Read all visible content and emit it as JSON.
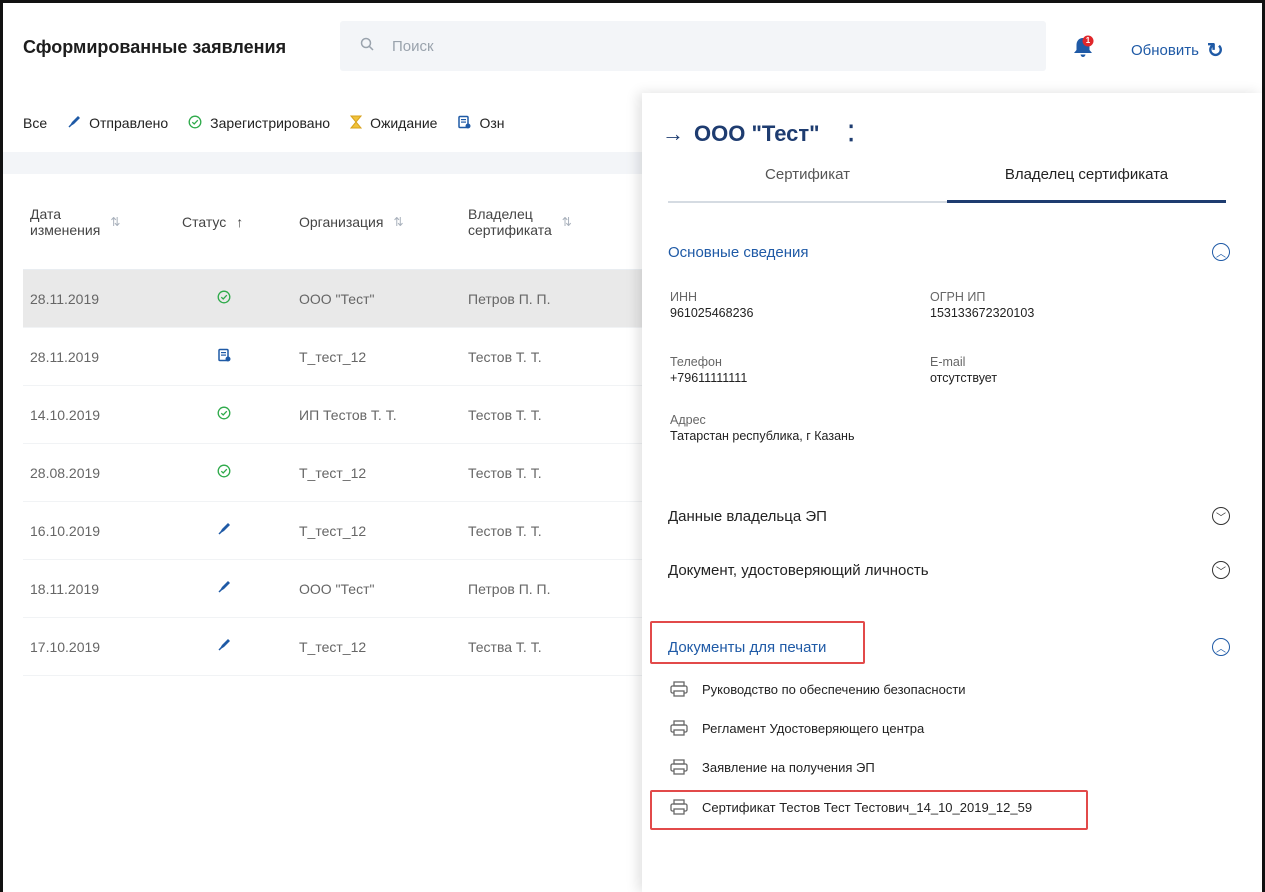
{
  "header": {
    "title": "Сформированные заявления",
    "search_placeholder": "Поиск",
    "notification_count": "1",
    "refresh_label": "Обновить"
  },
  "filters": [
    {
      "label": "Все",
      "icon": ""
    },
    {
      "label": "Отправлено",
      "icon": "rocket-icon"
    },
    {
      "label": "Зарегистрировано",
      "icon": "check-circle-icon"
    },
    {
      "label": "Ожидание",
      "icon": "hourglass-icon"
    },
    {
      "label": "Озн",
      "icon": "document-icon"
    }
  ],
  "table": {
    "columns": [
      {
        "line1": "Дата",
        "line2": "изменения"
      },
      {
        "line1": "Статус",
        "line2": ""
      },
      {
        "line1": "Организация",
        "line2": ""
      },
      {
        "line1": "Владелец",
        "line2": "сертификата"
      }
    ],
    "rows": [
      {
        "date": "28.11.2019",
        "status": "registered",
        "org": "ООО \"Тест\"",
        "owner": "Петров П. П."
      },
      {
        "date": "28.11.2019",
        "status": "document",
        "org": "Т_тест_12",
        "owner": "Тестов Т. Т."
      },
      {
        "date": "14.10.2019",
        "status": "registered",
        "org": "ИП Тестов Т. Т.",
        "owner": "Тестов Т. Т."
      },
      {
        "date": "28.08.2019",
        "status": "registered",
        "org": "Т_тест_12",
        "owner": "Тестов Т. Т."
      },
      {
        "date": "16.10.2019",
        "status": "sent",
        "org": "Т_тест_12",
        "owner": "Тестов Т. Т."
      },
      {
        "date": "18.11.2019",
        "status": "sent",
        "org": "ООО \"Тест\"",
        "owner": "Петров П. П."
      },
      {
        "date": "17.10.2019",
        "status": "sent",
        "org": "Т_тест_12",
        "owner": "Тества Т. Т."
      }
    ]
  },
  "panel": {
    "title": "ООО \"Тест\"",
    "tabs": [
      "Сертификат",
      "Владелец сертификата"
    ],
    "main_section": "Основные сведения",
    "fields": {
      "inn_label": "ИНН",
      "inn": "961025468236",
      "ogrn_label": "ОГРН ИП",
      "ogrn": "153133672320103",
      "phone_label": "Телефон",
      "phone": "+79611111111",
      "email_label": "E-mail",
      "email": "отсутствует",
      "address_label": "Адрес",
      "address": "Татарстан республика, г Казань"
    },
    "owner_data_section": "Данные владельца ЭП",
    "identity_section": "Документ, удостоверяющий личность",
    "print_section": "Документы для печати",
    "documents": [
      "Руководство по обеспечению безопасности",
      "Регламент Удостоверяющего центра",
      "Заявление на получения ЭП",
      "Сертификат Тестов Тест Тестович_14_10_2019_12_59"
    ]
  },
  "colors": {
    "accent": "#1f5aa6",
    "title_dark": "#1e3c70",
    "highlight": "#e24a4a",
    "status_green": "#2eaa4a"
  }
}
